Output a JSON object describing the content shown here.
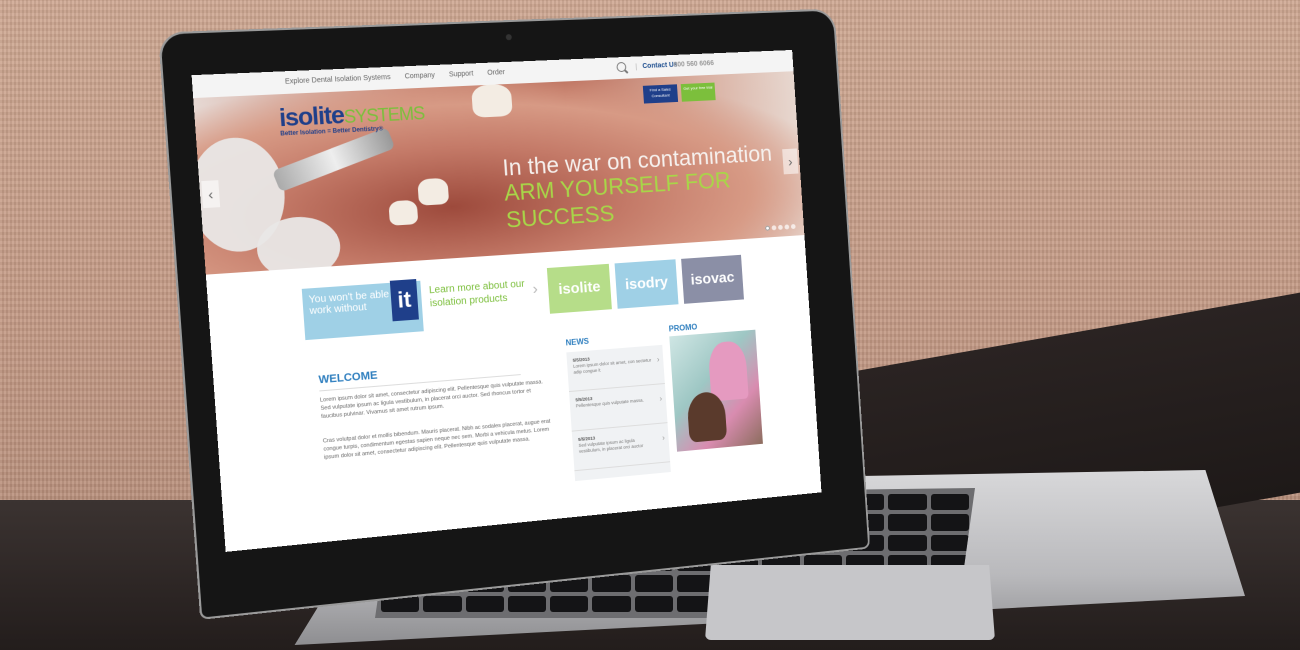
{
  "nav": {
    "links": [
      "Explore Dental Isolation Systems",
      "Company",
      "Support",
      "Order"
    ],
    "contact": "Contact Us",
    "phone": "800 560 6066"
  },
  "logo": {
    "brand_a": "isolite",
    "brand_b": "SYSTEMS",
    "tagline": "Better Isolation = Better Dentistry®"
  },
  "hero": {
    "line1": "In the war on contamination",
    "line2": "ARM YOURSELF FOR SUCCESS",
    "btn1": "Find a Sales Consultant",
    "btn2": "Get your free trial",
    "slides": 5,
    "active_slide": 1
  },
  "promo_banner": {
    "wont": "You won't be able to work without",
    "it": "it",
    "learn": "Learn more about our isolation products",
    "products": [
      "isolite",
      "isodry",
      "isovac"
    ]
  },
  "welcome": {
    "title": "WELCOME",
    "p1": "Lorem ipsum dolor sit amet, consectetur adipiscing elit. Pellentesque quis vulputate massa. Sed vulputate ipsum ac ligula vestibulum, in placerat orci auctor. Sed rhoncus tortor et faucibus pulvinar. Vivamus sit amet rutrum ipsum.",
    "p2": "Cras volutpat dolor et mollis bibendum. Mauris placerat. Nibh ac sodales placerat, augue erat congue turpis, condimentum egestas sapien neque nec sem. Morbi a vehicula metus. Lorem ipsum dolor sit amet, consectetur adipiscing elit. Pellentesque quis vulputate massa."
  },
  "news": {
    "title": "NEWS",
    "items": [
      {
        "date": "5/5/2013",
        "text": "Lorem ipsum dolor sit amet, con sectetur adip congue it"
      },
      {
        "date": "5/5/2013",
        "text": "Pellentesque quis vulputate massa."
      },
      {
        "date": "5/5/2013",
        "text": "Sed vulputate ipsum ac ligula vestibulum, in placerat orci auctor"
      }
    ]
  },
  "promo": {
    "title": "PROMO"
  },
  "colors": {
    "blue": "#1f3f8a",
    "green": "#7cbf3c",
    "accent": "#2f7fbf"
  }
}
